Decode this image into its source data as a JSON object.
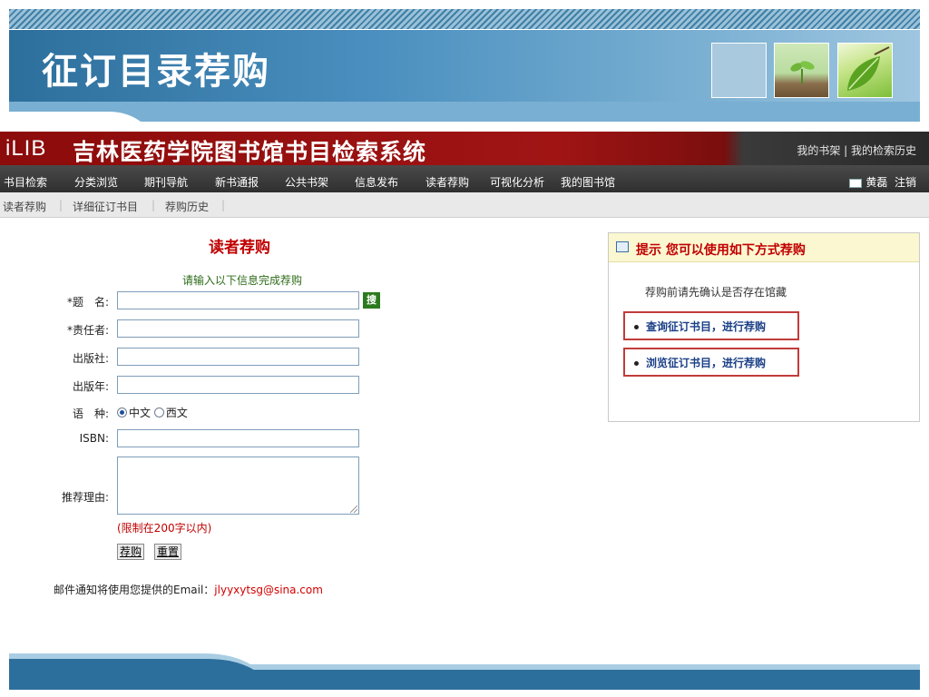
{
  "slide": {
    "title": "征订目录荐购"
  },
  "header": {
    "logo": "iLIB",
    "system_title": "吉林医药学院图书馆书目检索系统",
    "top_links": "我的书架 | 我的检索历史"
  },
  "nav": {
    "items": [
      "书目检索",
      "分类浏览",
      "期刊导航",
      "新书通报",
      "公共书架",
      "信息发布",
      "读者荐购",
      "可视化分析",
      "我的图书馆"
    ],
    "user_name": "黄磊",
    "logout": "注销"
  },
  "subnav": {
    "items": [
      "读者荐购",
      "详细征订书目",
      "荐购历史"
    ]
  },
  "form": {
    "heading": "读者荐购",
    "subheading": "请输入以下信息完成荐购",
    "labels": {
      "title": "*题　名:",
      "author": "*责任者:",
      "publisher": "出版社:",
      "year": "出版年:",
      "language": "语　种:",
      "isbn": "ISBN:",
      "reason": "推荐理由:"
    },
    "search_button": "搜",
    "language_options": [
      "中文",
      "西文"
    ],
    "language_selected": "中文",
    "limit_note": "(限制在200字以内)",
    "submit_button": "荐购",
    "reset_button": "重置",
    "email_prefix": "邮件通知将使用您提供的Email：",
    "email": "jlyyxytsg@sina.com"
  },
  "tip": {
    "title": "提示  您可以使用如下方式荐购",
    "note": "荐购前请先确认是否存在馆藏",
    "links": [
      "查询征订书目，进行荐购",
      "浏览征订书目，进行荐购"
    ]
  }
}
